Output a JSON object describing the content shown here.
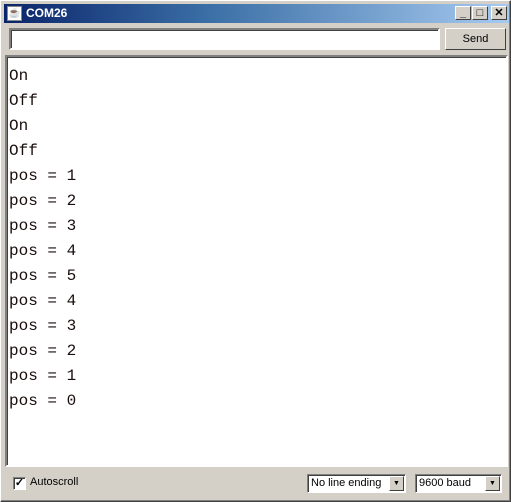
{
  "window": {
    "title": "COM26",
    "icon": "java-cup-icon",
    "controls": {
      "minimize": "_",
      "maximize": "□",
      "close": "✕"
    }
  },
  "toolbar": {
    "input_value": "",
    "send_label": "Send"
  },
  "output": {
    "lines": [
      "On",
      "Off",
      "On",
      "Off",
      "pos = 1",
      "pos = 2",
      "pos = 3",
      "pos = 4",
      "pos = 5",
      "pos = 4",
      "pos = 3",
      "pos = 2",
      "pos = 1",
      "pos = 0"
    ]
  },
  "footer": {
    "autoscroll_label": "Autoscroll",
    "autoscroll_checked": true,
    "line_ending": "No line ending",
    "baud": "9600 baud"
  }
}
